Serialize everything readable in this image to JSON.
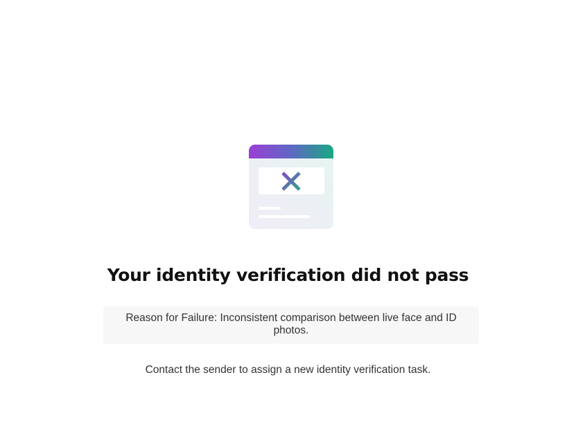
{
  "page": {
    "illustration_icon": "verification-failed-card-icon",
    "title": "Your identity verification did not pass",
    "reason_label": "Reason for Failure: ",
    "reason_text": "Inconsistent comparison between live face and ID photos.",
    "hint": "Contact the sender to assign a new identity verification task."
  },
  "colors": {
    "gradient_start": "#9b3fd6",
    "gradient_end": "#19a883",
    "cross_start": "#7a4fc8",
    "cross_end": "#3a9a8c",
    "reason_background": "#f7f7f7"
  }
}
